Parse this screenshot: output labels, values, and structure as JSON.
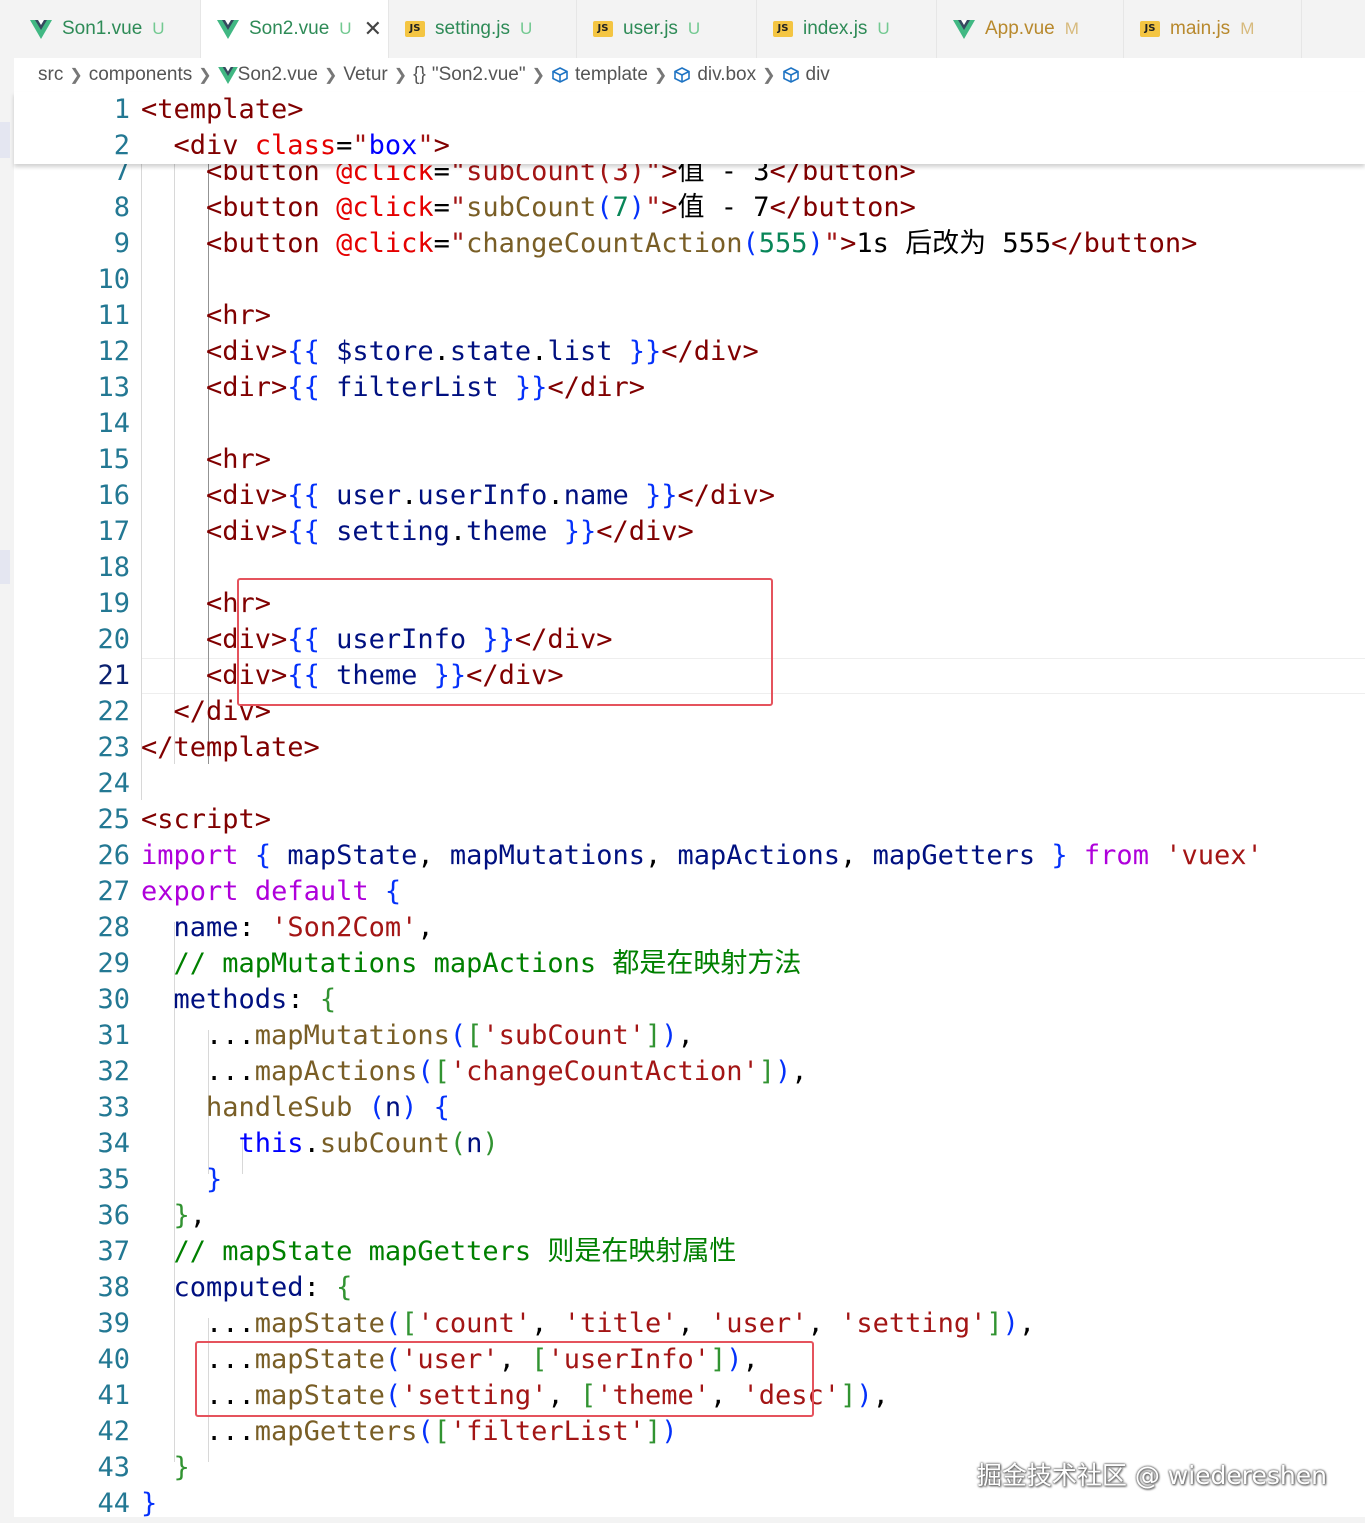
{
  "tabs": [
    {
      "label": "Son1.vue",
      "status": "U",
      "icon": "vue-icon",
      "active": false
    },
    {
      "label": "Son2.vue",
      "status": "U",
      "icon": "vue-icon",
      "active": true,
      "close": "✕"
    },
    {
      "label": "setting.js",
      "status": "U",
      "icon": "js-icon",
      "active": false
    },
    {
      "label": "user.js",
      "status": "U",
      "icon": "js-icon",
      "active": false
    },
    {
      "label": "index.js",
      "status": "U",
      "icon": "js-icon",
      "active": false
    },
    {
      "label": "App.vue",
      "status": "M",
      "icon": "vue-icon",
      "active": false
    },
    {
      "label": "main.js",
      "status": "M",
      "icon": "js-icon",
      "active": false
    }
  ],
  "js_badge": "JS",
  "breadcrumb": {
    "items": [
      "src",
      "components",
      "Son2.vue",
      "Vetur",
      "\"Son2.vue\"",
      "template",
      "div.box",
      "div"
    ],
    "braces": "{}"
  },
  "colors": {
    "status_untracked": "#73c991",
    "status_modified": "#d7ba7d",
    "vue_green": "#41b883",
    "vue_dark": "#35495e",
    "highlight_box": "#e5535d",
    "line_number": "#237893",
    "current_line_number": "#0b216f"
  },
  "current_line": "21",
  "sticky_lines": [
    {
      "num": "1",
      "tokens": [
        [
          "tg",
          "<template>"
        ]
      ]
    },
    {
      "num": "2",
      "tokens": [
        [
          "tg",
          "  <div "
        ],
        [
          "at",
          "class"
        ],
        [
          "pu",
          "="
        ],
        [
          "st",
          "\""
        ],
        [
          "sv",
          "box"
        ],
        [
          "st",
          "\""
        ],
        [
          "tg",
          ">"
        ]
      ]
    }
  ],
  "lines": [
    {
      "num": "7",
      "tokens": [
        [
          "tg",
          "    <button "
        ],
        [
          "at",
          "@click"
        ],
        [
          "pu",
          "="
        ],
        [
          "st",
          "\"subCount(3)\""
        ],
        [
          "tg",
          ">"
        ],
        [
          "pu",
          "值 - 3"
        ],
        [
          "tg",
          "</button>"
        ]
      ]
    },
    {
      "num": "8",
      "tokens": [
        [
          "tg",
          "    <button "
        ],
        [
          "at",
          "@click"
        ],
        [
          "pu",
          "="
        ],
        [
          "st",
          "\""
        ],
        [
          "fn",
          "subCount"
        ],
        [
          "br",
          "("
        ],
        [
          "nu",
          "7"
        ],
        [
          "br",
          ")"
        ],
        [
          "st",
          "\""
        ],
        [
          "tg",
          ">"
        ],
        [
          "pu",
          "值 - 7"
        ],
        [
          "tg",
          "</button>"
        ]
      ]
    },
    {
      "num": "9",
      "tokens": [
        [
          "tg",
          "    <button "
        ],
        [
          "at",
          "@click"
        ],
        [
          "pu",
          "="
        ],
        [
          "st",
          "\""
        ],
        [
          "fn",
          "changeCountAction"
        ],
        [
          "br",
          "("
        ],
        [
          "nu",
          "555"
        ],
        [
          "br",
          ")"
        ],
        [
          "st",
          "\""
        ],
        [
          "tg",
          ">"
        ],
        [
          "pu",
          "1s 后改为 555"
        ],
        [
          "tg",
          "</button>"
        ]
      ]
    },
    {
      "num": "10",
      "tokens": []
    },
    {
      "num": "11",
      "tokens": [
        [
          "tg",
          "    <hr>"
        ]
      ]
    },
    {
      "num": "12",
      "tokens": [
        [
          "tg",
          "    <div>"
        ],
        [
          "br",
          "{{ "
        ],
        [
          "pr",
          "$store"
        ],
        [
          "pu",
          "."
        ],
        [
          "pr",
          "state"
        ],
        [
          "pu",
          "."
        ],
        [
          "pr",
          "list"
        ],
        [
          "br",
          " }}"
        ],
        [
          "tg",
          "</div>"
        ]
      ]
    },
    {
      "num": "13",
      "tokens": [
        [
          "tg",
          "    <dir>"
        ],
        [
          "br",
          "{{ "
        ],
        [
          "pr",
          "filterList"
        ],
        [
          "br",
          " }}"
        ],
        [
          "tg",
          "</dir>"
        ]
      ]
    },
    {
      "num": "14",
      "tokens": []
    },
    {
      "num": "15",
      "tokens": [
        [
          "tg",
          "    <hr>"
        ]
      ]
    },
    {
      "num": "16",
      "tokens": [
        [
          "tg",
          "    <div>"
        ],
        [
          "br",
          "{{ "
        ],
        [
          "pr",
          "user"
        ],
        [
          "pu",
          "."
        ],
        [
          "pr",
          "userInfo"
        ],
        [
          "pu",
          "."
        ],
        [
          "pr",
          "name"
        ],
        [
          "br",
          " }}"
        ],
        [
          "tg",
          "</div>"
        ]
      ]
    },
    {
      "num": "17",
      "tokens": [
        [
          "tg",
          "    <div>"
        ],
        [
          "br",
          "{{ "
        ],
        [
          "pr",
          "setting"
        ],
        [
          "pu",
          "."
        ],
        [
          "pr",
          "theme"
        ],
        [
          "br",
          " }}"
        ],
        [
          "tg",
          "</div>"
        ]
      ]
    },
    {
      "num": "18",
      "tokens": []
    },
    {
      "num": "19",
      "tokens": [
        [
          "tg",
          "    <hr>"
        ]
      ]
    },
    {
      "num": "20",
      "tokens": [
        [
          "tg",
          "    <div>"
        ],
        [
          "br",
          "{{ "
        ],
        [
          "pr",
          "userInfo"
        ],
        [
          "br",
          " }}"
        ],
        [
          "tg",
          "</div>"
        ]
      ]
    },
    {
      "num": "21",
      "tokens": [
        [
          "tg",
          "    <div>"
        ],
        [
          "br",
          "{{ "
        ],
        [
          "pr",
          "theme"
        ],
        [
          "br",
          " }}"
        ],
        [
          "tg",
          "</div>"
        ]
      ]
    },
    {
      "num": "22",
      "tokens": [
        [
          "tg",
          "  </div>"
        ]
      ]
    },
    {
      "num": "23",
      "tokens": [
        [
          "tg",
          "</template>"
        ]
      ]
    },
    {
      "num": "24",
      "tokens": []
    },
    {
      "num": "25",
      "tokens": [
        [
          "tg",
          "<script>"
        ]
      ]
    },
    {
      "num": "26",
      "tokens": [
        [
          "kw",
          "import"
        ],
        [
          "pu",
          " "
        ],
        [
          "br",
          "{"
        ],
        [
          "pr",
          " mapState"
        ],
        [
          "pu",
          ", "
        ],
        [
          "pr",
          "mapMutations"
        ],
        [
          "pu",
          ", "
        ],
        [
          "pr",
          "mapActions"
        ],
        [
          "pu",
          ", "
        ],
        [
          "pr",
          "mapGetters "
        ],
        [
          "br",
          "}"
        ],
        [
          "pu",
          " "
        ],
        [
          "kw",
          "from"
        ],
        [
          "pu",
          " "
        ],
        [
          "st",
          "'vuex'"
        ]
      ]
    },
    {
      "num": "27",
      "tokens": [
        [
          "kw",
          "export"
        ],
        [
          "pu",
          " "
        ],
        [
          "kw",
          "default"
        ],
        [
          "pu",
          " "
        ],
        [
          "br",
          "{"
        ]
      ]
    },
    {
      "num": "28",
      "tokens": [
        [
          "pr",
          "  name"
        ],
        [
          "pu",
          ": "
        ],
        [
          "st",
          "'Son2Com'"
        ],
        [
          "pu",
          ","
        ]
      ]
    },
    {
      "num": "29",
      "tokens": [
        [
          "cm",
          "  // mapMutations mapActions 都是在映射方法"
        ]
      ]
    },
    {
      "num": "30",
      "tokens": [
        [
          "pr",
          "  methods"
        ],
        [
          "pu",
          ": "
        ],
        [
          "bg",
          "{"
        ]
      ]
    },
    {
      "num": "31",
      "tokens": [
        [
          "pu",
          "    ..."
        ],
        [
          "fn",
          "mapMutations"
        ],
        [
          "br",
          "("
        ],
        [
          "bg",
          "["
        ],
        [
          "st",
          "'subCount'"
        ],
        [
          "bg",
          "]"
        ],
        [
          "br",
          ")"
        ],
        [
          "pu",
          ","
        ]
      ]
    },
    {
      "num": "32",
      "tokens": [
        [
          "pu",
          "    ..."
        ],
        [
          "fn",
          "mapActions"
        ],
        [
          "br",
          "("
        ],
        [
          "bg",
          "["
        ],
        [
          "st",
          "'changeCountAction'"
        ],
        [
          "bg",
          "]"
        ],
        [
          "br",
          ")"
        ],
        [
          "pu",
          ","
        ]
      ]
    },
    {
      "num": "33",
      "tokens": [
        [
          "fn",
          "    handleSub"
        ],
        [
          "pu",
          " "
        ],
        [
          "br",
          "("
        ],
        [
          "pr",
          "n"
        ],
        [
          "br",
          ")"
        ],
        [
          "pu",
          " "
        ],
        [
          "br",
          "{"
        ]
      ]
    },
    {
      "num": "34",
      "tokens": [
        [
          "kb",
          "      this"
        ],
        [
          "pu",
          "."
        ],
        [
          "fn",
          "subCount"
        ],
        [
          "bg",
          "("
        ],
        [
          "pr",
          "n"
        ],
        [
          "bg",
          ")"
        ]
      ]
    },
    {
      "num": "35",
      "tokens": [
        [
          "br",
          "    }"
        ]
      ]
    },
    {
      "num": "36",
      "tokens": [
        [
          "bg",
          "  }"
        ],
        [
          "pu",
          ","
        ]
      ]
    },
    {
      "num": "37",
      "tokens": [
        [
          "cm",
          "  // mapState mapGetters 则是在映射属性"
        ]
      ]
    },
    {
      "num": "38",
      "tokens": [
        [
          "pr",
          "  computed"
        ],
        [
          "pu",
          ": "
        ],
        [
          "bg",
          "{"
        ]
      ]
    },
    {
      "num": "39",
      "tokens": [
        [
          "pu",
          "    ..."
        ],
        [
          "fn",
          "mapState"
        ],
        [
          "br",
          "("
        ],
        [
          "bg",
          "["
        ],
        [
          "st",
          "'count'"
        ],
        [
          "pu",
          ", "
        ],
        [
          "st",
          "'title'"
        ],
        [
          "pu",
          ", "
        ],
        [
          "st",
          "'user'"
        ],
        [
          "pu",
          ", "
        ],
        [
          "st",
          "'setting'"
        ],
        [
          "bg",
          "]"
        ],
        [
          "br",
          ")"
        ],
        [
          "pu",
          ","
        ]
      ]
    },
    {
      "num": "40",
      "tokens": [
        [
          "pu",
          "    ..."
        ],
        [
          "fn",
          "mapState"
        ],
        [
          "br",
          "("
        ],
        [
          "st",
          "'user'"
        ],
        [
          "pu",
          ", "
        ],
        [
          "bg",
          "["
        ],
        [
          "st",
          "'userInfo'"
        ],
        [
          "bg",
          "]"
        ],
        [
          "br",
          ")"
        ],
        [
          "pu",
          ","
        ]
      ]
    },
    {
      "num": "41",
      "tokens": [
        [
          "pu",
          "    ..."
        ],
        [
          "fn",
          "mapState"
        ],
        [
          "br",
          "("
        ],
        [
          "st",
          "'setting'"
        ],
        [
          "pu",
          ", "
        ],
        [
          "bg",
          "["
        ],
        [
          "st",
          "'theme'"
        ],
        [
          "pu",
          ", "
        ],
        [
          "st",
          "'desc'"
        ],
        [
          "bg",
          "]"
        ],
        [
          "br",
          ")"
        ],
        [
          "pu",
          ","
        ]
      ]
    },
    {
      "num": "42",
      "tokens": [
        [
          "pu",
          "    ..."
        ],
        [
          "fn",
          "mapGetters"
        ],
        [
          "br",
          "("
        ],
        [
          "bg",
          "["
        ],
        [
          "st",
          "'filterList'"
        ],
        [
          "bg",
          "]"
        ],
        [
          "br",
          ")"
        ]
      ]
    },
    {
      "num": "43",
      "tokens": [
        [
          "bg",
          "  }"
        ]
      ]
    },
    {
      "num": "44",
      "tokens": [
        [
          "br",
          "}"
        ]
      ]
    }
  ],
  "watermark": "掘金技术社区 @ wiedereshen"
}
